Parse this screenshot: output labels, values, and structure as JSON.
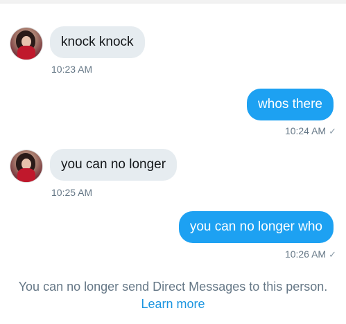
{
  "messages": [
    {
      "direction": "incoming",
      "text": "knock knock",
      "time": "10:23 AM"
    },
    {
      "direction": "outgoing",
      "text": "whos there",
      "time": "10:24 AM",
      "status_icon": "checkmark-icon"
    },
    {
      "direction": "incoming",
      "text": "you can no longer",
      "time": "10:25 AM"
    },
    {
      "direction": "outgoing",
      "text": "you can no longer who",
      "time": "10:26 AM",
      "status_icon": "checkmark-icon"
    }
  ],
  "notice": {
    "text": "You can no longer send Direct Messages to this person.",
    "link_text": "Learn more"
  },
  "colors": {
    "incoming_bubble": "#e6ecf0",
    "outgoing_bubble": "#1da1f2",
    "timestamp": "#657786",
    "link": "#1b95e0"
  },
  "check_glyph": "✓"
}
